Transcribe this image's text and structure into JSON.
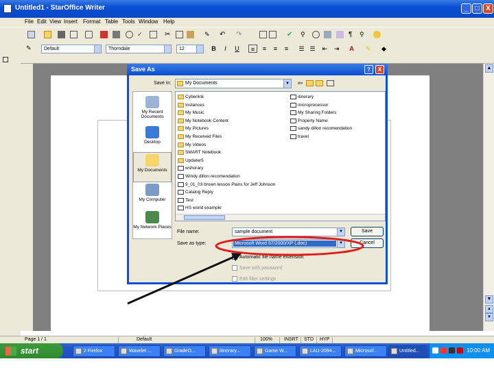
{
  "window": {
    "title": "Untitled1 - StarOffice Writer",
    "min": "_",
    "max": "□",
    "close": "X"
  },
  "menu": [
    "File",
    "Edit",
    "View",
    "Insert",
    "Format",
    "Table",
    "Tools",
    "Window",
    "Help"
  ],
  "toolbar2": {
    "style": "Default",
    "font": "Thorndale",
    "size": "12",
    "bold": "B",
    "italic": "I",
    "underline": "U"
  },
  "dialog": {
    "title": "Save As",
    "help": "?",
    "close": "X",
    "save_in_label": "Save in:",
    "save_in_value": "My Documents",
    "places": [
      "My Recent Documents",
      "Desktop",
      "My Documents",
      "My Computer",
      "My Network Places"
    ],
    "files_col1": [
      {
        "name": "Cyberlink",
        "type": "folder"
      },
      {
        "name": "Instances",
        "type": "folder"
      },
      {
        "name": "My Music",
        "type": "folder"
      },
      {
        "name": "My Notebook Content",
        "type": "folder"
      },
      {
        "name": "My Pictures",
        "type": "folder"
      },
      {
        "name": "My Received Files",
        "type": "folder"
      },
      {
        "name": "My Videos",
        "type": "folder"
      },
      {
        "name": "SMART Notebook",
        "type": "folder"
      },
      {
        "name": "Updater5",
        "type": "folder"
      },
      {
        "name": "wshorary",
        "type": "doc"
      },
      {
        "name": "Windy dillon recomendation",
        "type": "doc"
      },
      {
        "name": "9_01_03 brown lesson Plans for Jeff Johnson",
        "type": "doc"
      },
      {
        "name": "Catalog Reply",
        "type": "doc"
      },
      {
        "name": "Test",
        "type": "doc"
      },
      {
        "name": "HS world example",
        "type": "doc"
      }
    ],
    "files_col2": [
      {
        "name": "itinerary",
        "type": "doc"
      },
      {
        "name": "microprocessor",
        "type": "doc"
      },
      {
        "name": "My Sharing Folders",
        "type": "doc"
      },
      {
        "name": "Property Name",
        "type": "doc"
      },
      {
        "name": "sandy dillon recomendation",
        "type": "doc"
      },
      {
        "name": "travel",
        "type": "doc"
      }
    ],
    "filename_label": "File name:",
    "filename_value": "sample document",
    "filetype_label": "Save as type:",
    "filetype_value": "Microsoft Word 97/2000/XP (.doc)",
    "save_button": "Save",
    "cancel_button": "Cancel",
    "options": [
      {
        "label": "Automatic file name extension",
        "enabled": true
      },
      {
        "label": "Save with password",
        "enabled": false
      },
      {
        "label": "Edit filter settings",
        "enabled": false
      }
    ]
  },
  "status": {
    "page": "Page 1 / 1",
    "style": "Default",
    "zoom": "100%",
    "mode": "INSRT",
    "std": "STD",
    "hyp": "HYP"
  },
  "taskbar": {
    "start": "start",
    "tasks": [
      "2 Firefox",
      "Wavelet ...",
      "GradeO...",
      "itinerary...",
      "Game W...",
      "LAU-2094...",
      "Microsof...",
      "Untitled..."
    ],
    "clock": "10:00 AM"
  },
  "colors": {
    "accent": "#0a4fd4",
    "highlight": "#316ac5",
    "annotation": "#e21b1b"
  }
}
